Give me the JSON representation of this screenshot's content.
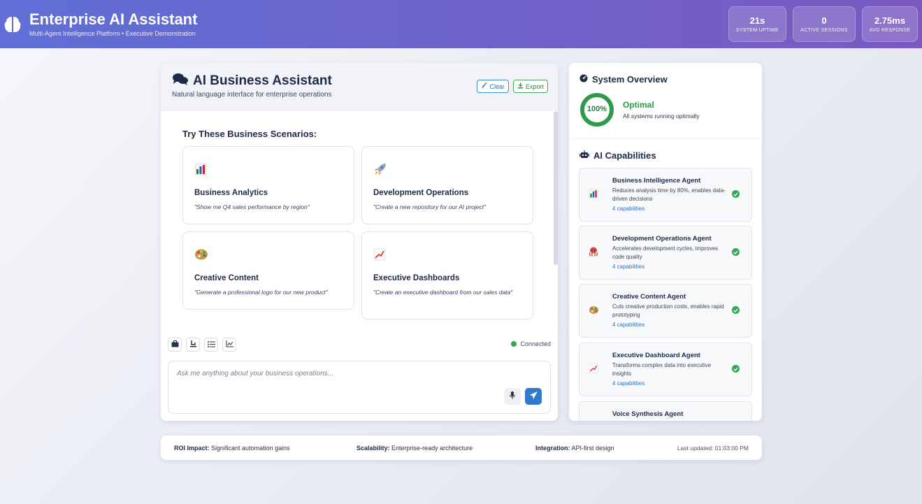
{
  "header": {
    "title": "Enterprise AI Assistant",
    "subtitle": "Multi-Agent Intelligence Platform • Executive Demonstration",
    "stats": [
      {
        "value": "21s",
        "label": "SYSTEM UPTIME"
      },
      {
        "value": "0",
        "label": "ACTIVE SESSIONS"
      },
      {
        "value": "2.75ms",
        "label": "AVG RESPONSE"
      }
    ]
  },
  "chat": {
    "title": "AI Business Assistant",
    "subtitle": "Natural language interface for enterprise operations",
    "clear_label": "Clear",
    "export_label": "Export",
    "scenarios_title": "Try These Business Scenarios:",
    "scenarios": [
      {
        "title": "Business Analytics",
        "query": "\"Show me Q4 sales performance by region\"",
        "icon": "bar-chart-icon"
      },
      {
        "title": "Development Operations",
        "query": "\"Create a new repository for our AI project\"",
        "icon": "rocket-icon"
      },
      {
        "title": "Creative Content",
        "query": "\"Generate a professional logo for our new product\"",
        "icon": "palette-icon"
      },
      {
        "title": "Executive Dashboards",
        "query": "\"Create an executive dashboard from our sales data\"",
        "icon": "trend-chart-icon"
      }
    ],
    "connection_status": "Connected",
    "input_placeholder": "Ask me anything about your business operations..."
  },
  "side": {
    "overview_title": "System Overview",
    "health_percent": "100%",
    "status_title": "Optimal",
    "status_desc": "All systems running optimally",
    "capabilities_title": "AI Capabilities",
    "agents": [
      {
        "name": "Business Intelligence Agent",
        "desc": "Reduces analysis time by 80%, enables data-driven decisions",
        "caps": "4 capabilities",
        "icon": "bar-chart-icon"
      },
      {
        "name": "Development Operations Agent",
        "desc": "Accelerates development cycles, improves code quality",
        "caps": "4 capabilities",
        "icon": "octopus-icon"
      },
      {
        "name": "Creative Content Agent",
        "desc": "Cuts creative production costs, enables rapid prototyping",
        "caps": "4 capabilities",
        "icon": "palette-icon"
      },
      {
        "name": "Executive Dashboard Agent",
        "desc": "Transforms complex data into executive insights",
        "caps": "4 capabilities",
        "icon": "trend-chart-icon"
      },
      {
        "name": "Voice Synthesis Agent",
        "desc": "",
        "caps": "",
        "icon": ""
      }
    ]
  },
  "footer": {
    "roi_label": "ROI Impact:",
    "roi_value": "Significant automation gains",
    "scal_label": "Scalability:",
    "scal_value": "Enterprise-ready architecture",
    "int_label": "Integration:",
    "int_value": "API-first design",
    "updated": "Last updated: 01:03:00 PM"
  },
  "colors": {
    "header_start": "#5f6fd6",
    "header_end": "#7a5ac0",
    "success": "#32a852",
    "primary": "#2f7ad0"
  }
}
